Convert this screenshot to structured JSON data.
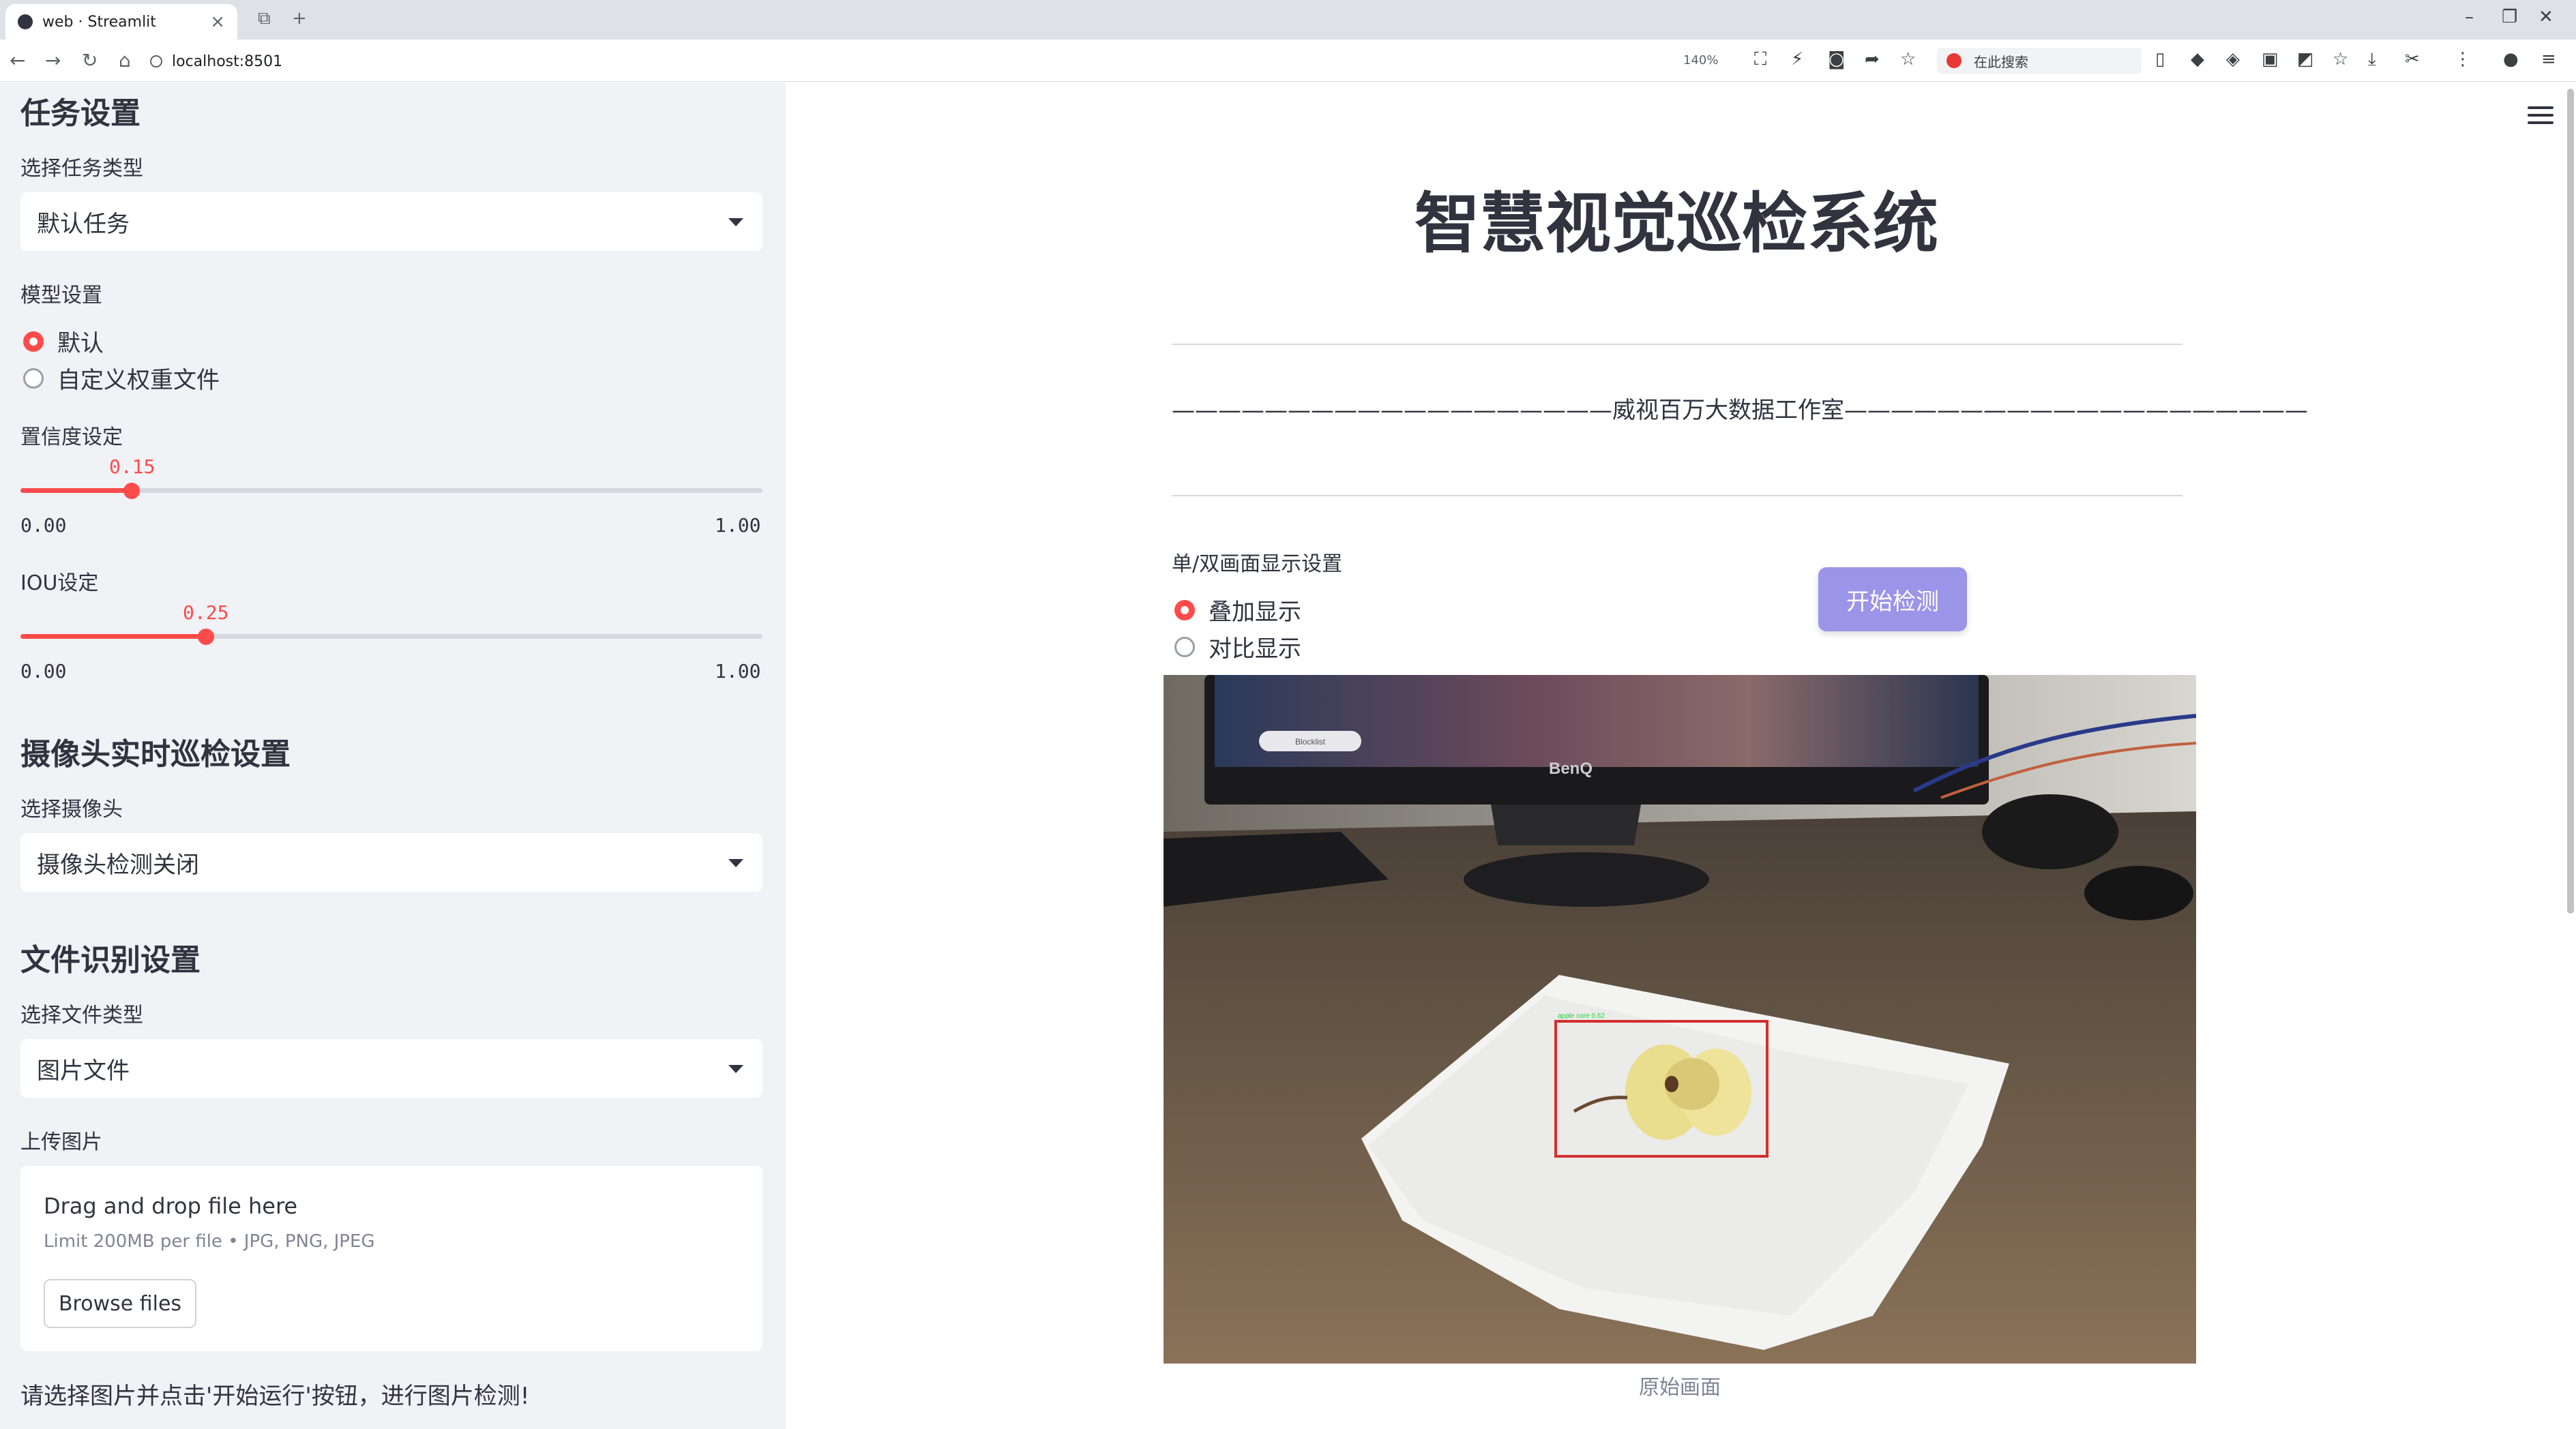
{
  "browser": {
    "tab_title": "web · Streamlit",
    "tab_close": "×",
    "new_tab": "+",
    "url": "localhost:8501",
    "zoom": "140%",
    "search_placeholder": "在此搜索"
  },
  "sidebar": {
    "task_section": {
      "heading": "任务设置",
      "task_type_label": "选择任务类型",
      "task_type_value": "默认任务"
    },
    "model_section": {
      "label": "模型设置",
      "options": [
        "默认",
        "自定义权重文件"
      ],
      "selected_index": 0
    },
    "confidence": {
      "label": "置信度设定",
      "value": "0.15",
      "value_fraction": 0.15,
      "min": "0.00",
      "max": "1.00"
    },
    "iou": {
      "label": "IOU设定",
      "value": "0.25",
      "value_fraction": 0.25,
      "min": "0.00",
      "max": "1.00"
    },
    "camera_section": {
      "heading": "摄像头实时巡检设置",
      "camera_label": "选择摄像头",
      "camera_value": "摄像头检测关闭"
    },
    "file_section": {
      "heading": "文件识别设置",
      "file_type_label": "选择文件类型",
      "file_type_value": "图片文件",
      "upload_label": "上传图片",
      "drag_text": "Drag and drop file here",
      "limit_text": "Limit 200MB per file • JPG, PNG, JPEG",
      "browse_label": "Browse files"
    },
    "hint": "请选择图片并点击'开始运行'按钮，进行图片检测!"
  },
  "main": {
    "title": "智慧视觉巡检系统",
    "credit": "———————————————————威视百万大数据工作室————————————————————",
    "display_mode_label": "单/双画面显示设置",
    "display_options": [
      "叠加显示",
      "对比显示"
    ],
    "selected_display_index": 0,
    "start_button": "开始检测",
    "image_caption": "原始画面",
    "monitor_brand": "BenQ",
    "screen_button_text": "Blocklist",
    "detection_label": "apple core 0.62"
  },
  "colors": {
    "accent": "#ff4b4b",
    "button": "#9b94e9",
    "sidebar_bg": "#f0f2f6",
    "detection_box": "#d32f2f"
  }
}
